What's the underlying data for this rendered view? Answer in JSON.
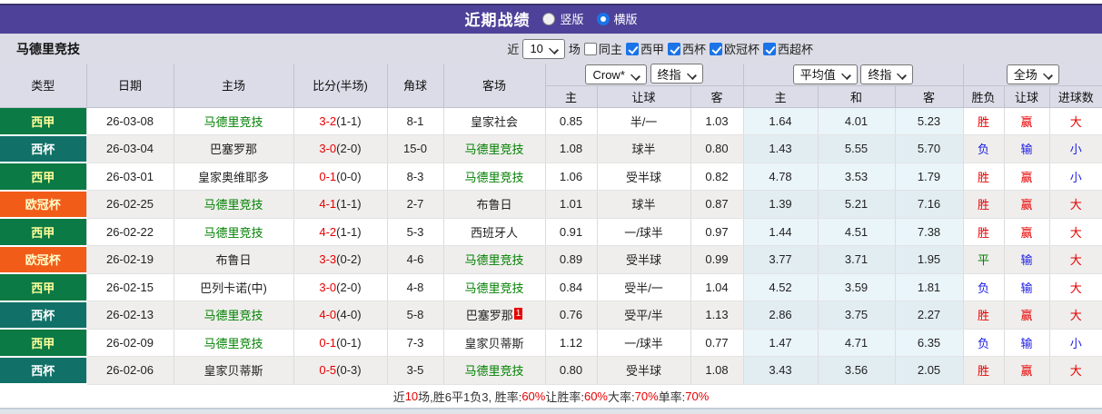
{
  "title_bar": {
    "title": "近期战绩",
    "radio_vertical": "竖版",
    "radio_horizontal": "横版",
    "selected": "横版"
  },
  "toolbar": {
    "team": "马德里竞技",
    "near_label": "近",
    "count_value": "10",
    "games_label": "场",
    "same_home_label": "同主",
    "same_home_checked": false,
    "leagues": [
      {
        "label": "西甲",
        "checked": true
      },
      {
        "label": "西杯",
        "checked": true
      },
      {
        "label": "欧冠杯",
        "checked": true
      },
      {
        "label": "西超杯",
        "checked": true
      }
    ]
  },
  "table_header": {
    "type": "类型",
    "date": "日期",
    "home": "主场",
    "score": "比分(半场)",
    "corner": "角球",
    "away": "客场",
    "crow_select": "Crow*",
    "crow_final_select": "终指",
    "avg_select": "平均值",
    "avg_final_select": "终指",
    "scope_select": "全场",
    "sub_home": "主",
    "sub_hcap": "让球",
    "sub_away": "客",
    "sub_avg_home": "主",
    "sub_avg_draw": "和",
    "sub_avg_away": "客",
    "sub_result": "胜负",
    "sub_hcap_result": "让球",
    "sub_goals": "进球数"
  },
  "rows": [
    {
      "type": "西甲",
      "type_class": "liga",
      "date": "26-03-08",
      "home": "马德里竞技",
      "home_hl": true,
      "score": "3-2",
      "half": "(1-1)",
      "corner": "8-1",
      "away": "皇家社会",
      "away_hl": false,
      "away_badge": "",
      "crow_home": "0.85",
      "crow_hcap": "半/一",
      "crow_away": "1.03",
      "avg_home": "1.64",
      "avg_draw": "4.01",
      "avg_away": "5.23",
      "result": "胜",
      "result_color": "red",
      "hcap_result": "赢",
      "hcap_result_color": "red",
      "goals": "大",
      "goals_color": "red"
    },
    {
      "type": "西杯",
      "type_class": "copa",
      "date": "26-03-04",
      "home": "巴塞罗那",
      "home_hl": false,
      "score": "3-0",
      "half": "(2-0)",
      "corner": "15-0",
      "away": "马德里竞技",
      "away_hl": true,
      "away_badge": "",
      "crow_home": "1.08",
      "crow_hcap": "球半",
      "crow_away": "0.80",
      "avg_home": "1.43",
      "avg_draw": "5.55",
      "avg_away": "5.70",
      "result": "负",
      "result_color": "blue",
      "hcap_result": "输",
      "hcap_result_color": "blue",
      "goals": "小",
      "goals_color": "blue"
    },
    {
      "type": "西甲",
      "type_class": "liga",
      "date": "26-03-01",
      "home": "皇家奥维耶多",
      "home_hl": false,
      "score": "0-1",
      "half": "(0-0)",
      "corner": "8-3",
      "away": "马德里竞技",
      "away_hl": true,
      "away_badge": "",
      "crow_home": "1.06",
      "crow_hcap": "受半球",
      "crow_away": "0.82",
      "avg_home": "4.78",
      "avg_draw": "3.53",
      "avg_away": "1.79",
      "result": "胜",
      "result_color": "red",
      "hcap_result": "赢",
      "hcap_result_color": "red",
      "goals": "小",
      "goals_color": "blue"
    },
    {
      "type": "欧冠杯",
      "type_class": "ucl",
      "date": "26-02-25",
      "home": "马德里竞技",
      "home_hl": true,
      "score": "4-1",
      "half": "(1-1)",
      "corner": "2-7",
      "away": "布鲁日",
      "away_hl": false,
      "away_badge": "",
      "crow_home": "1.01",
      "crow_hcap": "球半",
      "crow_away": "0.87",
      "avg_home": "1.39",
      "avg_draw": "5.21",
      "avg_away": "7.16",
      "result": "胜",
      "result_color": "red",
      "hcap_result": "赢",
      "hcap_result_color": "red",
      "goals": "大",
      "goals_color": "red"
    },
    {
      "type": "西甲",
      "type_class": "liga",
      "date": "26-02-22",
      "home": "马德里竞技",
      "home_hl": true,
      "score": "4-2",
      "half": "(1-1)",
      "corner": "5-3",
      "away": "西班牙人",
      "away_hl": false,
      "away_badge": "",
      "crow_home": "0.91",
      "crow_hcap": "一/球半",
      "crow_away": "0.97",
      "avg_home": "1.44",
      "avg_draw": "4.51",
      "avg_away": "7.38",
      "result": "胜",
      "result_color": "red",
      "hcap_result": "赢",
      "hcap_result_color": "red",
      "goals": "大",
      "goals_color": "red"
    },
    {
      "type": "欧冠杯",
      "type_class": "ucl",
      "date": "26-02-19",
      "home": "布鲁日",
      "home_hl": false,
      "score": "3-3",
      "half": "(0-2)",
      "corner": "4-6",
      "away": "马德里竞技",
      "away_hl": true,
      "away_badge": "",
      "crow_home": "0.89",
      "crow_hcap": "受半球",
      "crow_away": "0.99",
      "avg_home": "3.77",
      "avg_draw": "3.71",
      "avg_away": "1.95",
      "result": "平",
      "result_color": "green",
      "hcap_result": "输",
      "hcap_result_color": "blue",
      "goals": "大",
      "goals_color": "red"
    },
    {
      "type": "西甲",
      "type_class": "liga",
      "date": "26-02-15",
      "home": "巴列卡诺(中)",
      "home_hl": false,
      "score": "3-0",
      "half": "(2-0)",
      "corner": "4-8",
      "away": "马德里竞技",
      "away_hl": true,
      "away_badge": "",
      "crow_home": "0.84",
      "crow_hcap": "受半/一",
      "crow_away": "1.04",
      "avg_home": "4.52",
      "avg_draw": "3.59",
      "avg_away": "1.81",
      "result": "负",
      "result_color": "blue",
      "hcap_result": "输",
      "hcap_result_color": "blue",
      "goals": "大",
      "goals_color": "red"
    },
    {
      "type": "西杯",
      "type_class": "copa",
      "date": "26-02-13",
      "home": "马德里竞技",
      "home_hl": true,
      "score": "4-0",
      "half": "(4-0)",
      "corner": "5-8",
      "away": "巴塞罗那",
      "away_hl": false,
      "away_badge": "1",
      "crow_home": "0.76",
      "crow_hcap": "受平/半",
      "crow_away": "1.13",
      "avg_home": "2.86",
      "avg_draw": "3.75",
      "avg_away": "2.27",
      "result": "胜",
      "result_color": "red",
      "hcap_result": "赢",
      "hcap_result_color": "red",
      "goals": "大",
      "goals_color": "red"
    },
    {
      "type": "西甲",
      "type_class": "liga",
      "date": "26-02-09",
      "home": "马德里竞技",
      "home_hl": true,
      "score": "0-1",
      "half": "(0-1)",
      "corner": "7-3",
      "away": "皇家贝蒂斯",
      "away_hl": false,
      "away_badge": "",
      "crow_home": "1.12",
      "crow_hcap": "一/球半",
      "crow_away": "0.77",
      "avg_home": "1.47",
      "avg_draw": "4.71",
      "avg_away": "6.35",
      "result": "负",
      "result_color": "blue",
      "hcap_result": "输",
      "hcap_result_color": "blue",
      "goals": "小",
      "goals_color": "blue"
    },
    {
      "type": "西杯",
      "type_class": "copa",
      "date": "26-02-06",
      "home": "皇家贝蒂斯",
      "home_hl": false,
      "score": "0-5",
      "half": "(0-3)",
      "corner": "3-5",
      "away": "马德里竞技",
      "away_hl": true,
      "away_badge": "",
      "crow_home": "0.80",
      "crow_hcap": "受半球",
      "crow_away": "1.08",
      "avg_home": "3.43",
      "avg_draw": "3.56",
      "avg_away": "2.05",
      "result": "胜",
      "result_color": "red",
      "hcap_result": "赢",
      "hcap_result_color": "red",
      "goals": "大",
      "goals_color": "red"
    }
  ],
  "summary": {
    "p1": "近",
    "n1": "10",
    "p2": "场,胜6平1负3, 胜率:",
    "n2": "60%",
    "p3": " 让胜率:",
    "n3": "60%",
    "p4": " 大率:",
    "n4": "70%",
    "p5": " 单率:",
    "n5": "70%"
  },
  "colors": {
    "accent_purple": "#4e4199",
    "liga_green": "#0b7a45",
    "copa_teal": "#117168",
    "ucl_orange": "#f25c19",
    "team_highlight_green": "#008000",
    "win_red": "#e80000",
    "lose_blue": "#1a1ae6",
    "draw_green": "#008000"
  }
}
